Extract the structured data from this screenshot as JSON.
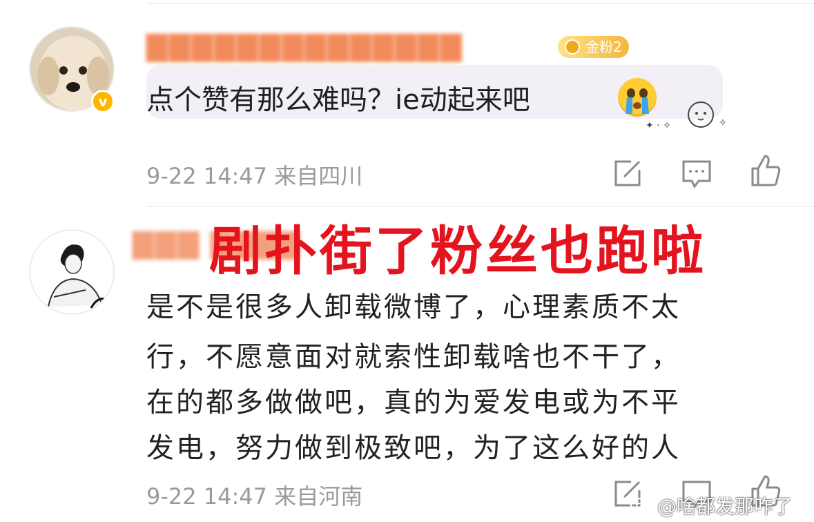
{
  "comment1": {
    "fan_badge": "金粉2",
    "reply_text": "点个赞有那么难吗？ie动起来吧",
    "meta": "9-22 14:47  来自四川"
  },
  "comment2": {
    "overlay_title": "剧扑街了粉丝也跑啦",
    "body_lines": [
      "是不是很多人卸载微博了，心理素质不太",
      "行，不愿意面对就索性卸载啥也不干了，",
      "在的都多做做吧，真的为爱发电或为不平",
      "发电，努力做到极致吧，为了这么好的人"
    ],
    "meta": "9-22 14:47  来自河南"
  },
  "watermark": "@啥都发那咋了",
  "icons": [
    "repost-icon",
    "comment-icon",
    "like-icon",
    "cry-emoji-icon",
    "verified-badge-icon",
    "weibo-logo-icon"
  ],
  "colors": {
    "red_overlay": "#e4141e",
    "meta_gray": "#9a9a9a",
    "badge_gold": "#f5b638",
    "name_blur": "#f28b5c"
  }
}
